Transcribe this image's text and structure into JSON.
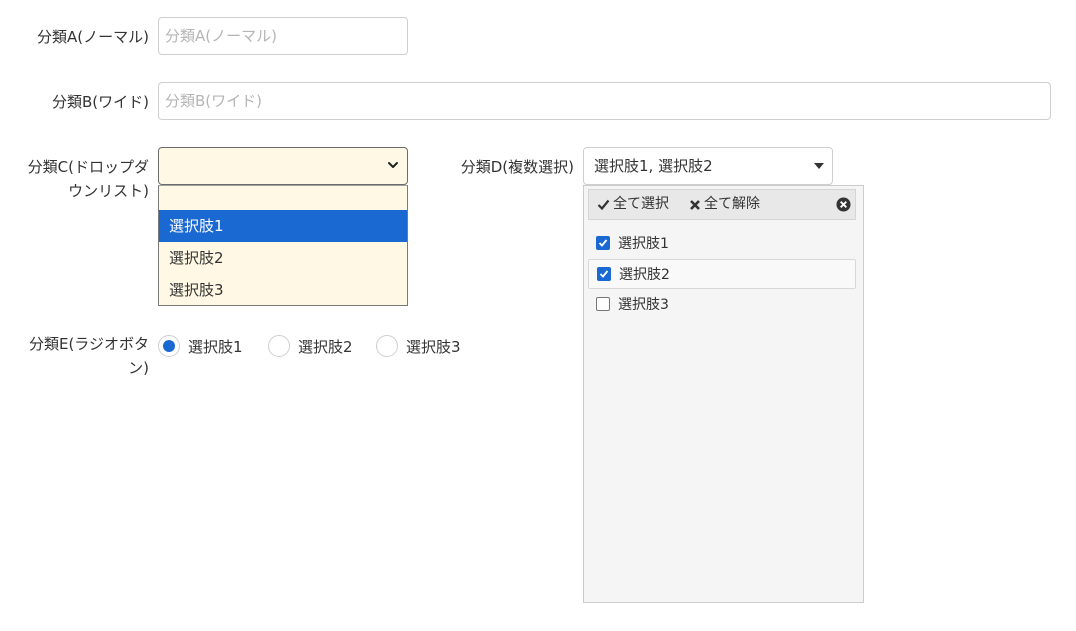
{
  "fieldA": {
    "label": "分類A(ノーマル)",
    "placeholder": "分類A(ノーマル)",
    "value": ""
  },
  "fieldB": {
    "label": "分類B(ワイド)",
    "placeholder": "分類B(ワイド)",
    "value": ""
  },
  "fieldC": {
    "label_line1": "分類C(ドロップダ",
    "label_line2": "ウンリスト)",
    "value": "",
    "options": [
      "",
      "選択肢1",
      "選択肢2",
      "選択肢3"
    ],
    "highlighted": "選択肢1"
  },
  "fieldD": {
    "label": "分類D(複数選択)",
    "value": "選択肢1, 選択肢2",
    "toolbar": {
      "select_all": "全て選択",
      "deselect_all": "全て解除"
    },
    "options": [
      {
        "label": "選択肢1",
        "checked": true
      },
      {
        "label": "選択肢2",
        "checked": true
      },
      {
        "label": "選択肢3",
        "checked": false
      }
    ]
  },
  "fieldE": {
    "label_line1": "分類E(ラジオボタ",
    "label_line2": "ン)",
    "options": [
      {
        "label": "選択肢1",
        "selected": true
      },
      {
        "label": "選択肢2",
        "selected": false
      },
      {
        "label": "選択肢3",
        "selected": false
      }
    ]
  },
  "colors": {
    "accent": "#1a68d1",
    "dropdown_bg": "#fff8e4",
    "panel_bg": "#f5f5f5"
  }
}
